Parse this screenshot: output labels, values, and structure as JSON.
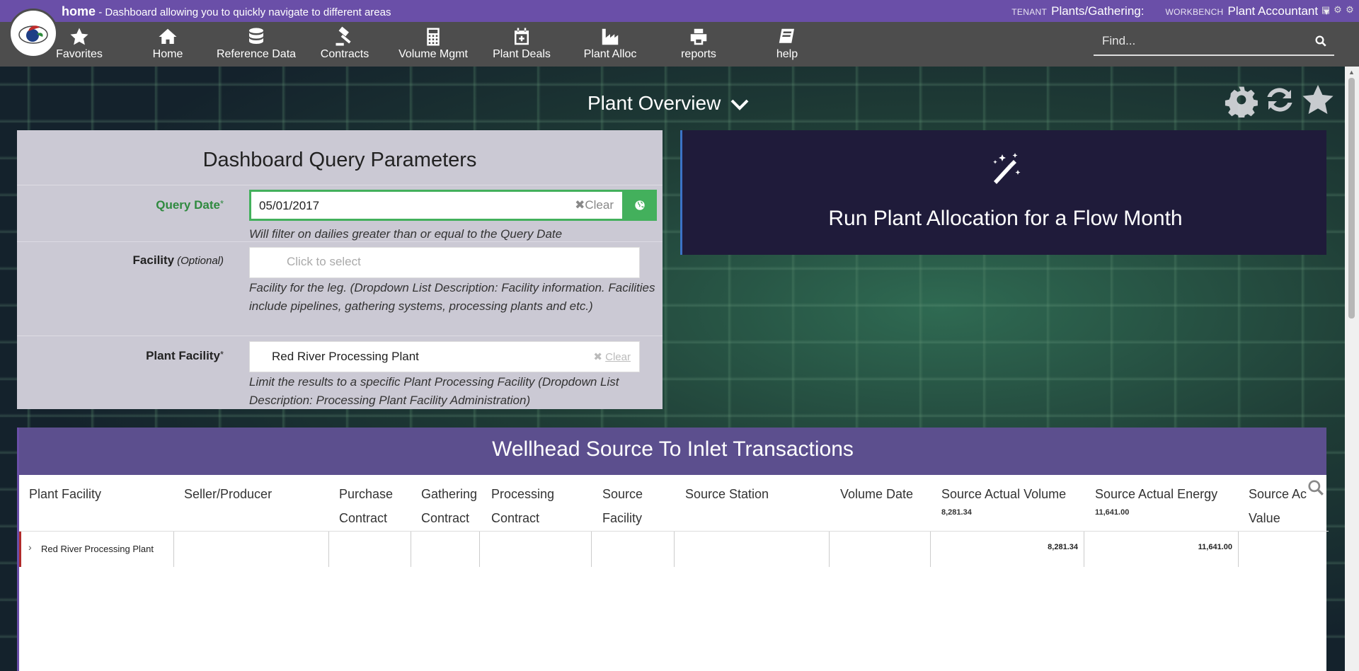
{
  "topbar": {
    "page": "home",
    "description": "- Dashboard allowing you to quickly navigate to different areas",
    "tenant_label": "TENANT",
    "tenant_value": "Plants/Gathering:",
    "workbench_label": "WORKBENCH",
    "workbench_value": "Plant Accountant"
  },
  "nav": {
    "items": [
      {
        "label": "Favorites",
        "icon": "star-icon"
      },
      {
        "label": "Home",
        "icon": "home-icon"
      },
      {
        "label": "Reference Data",
        "icon": "database-icon"
      },
      {
        "label": "Contracts",
        "icon": "gavel-icon"
      },
      {
        "label": "Volume Mgmt",
        "icon": "calculator-icon"
      },
      {
        "label": "Plant Deals",
        "icon": "calendar-plus-icon"
      },
      {
        "label": "Plant Alloc",
        "icon": "factory-icon"
      },
      {
        "label": "reports",
        "icon": "printer-icon"
      },
      {
        "label": "help",
        "icon": "book-icon"
      }
    ],
    "find_placeholder": "Find..."
  },
  "page_title": "Plant Overview",
  "params": {
    "title": "Dashboard Query Parameters",
    "query_date": {
      "label": "Query Date",
      "value": "05/01/2017",
      "clear": "Clear",
      "hint": "Will filter on dailies greater than or equal to the Query Date"
    },
    "facility": {
      "label": "Facility",
      "optional": "(Optional)",
      "placeholder": "Click to select",
      "hint": "Facility for the leg. (Dropdown List Description: Facility information. Facilities include pipelines, gathering systems, processing plants and etc.)"
    },
    "plant_facility": {
      "label": "Plant Facility",
      "value": "Red River Processing Plant",
      "clear": "Clear",
      "hint": "Limit the results to a specific Plant Processing Facility (Dropdown List Description: Processing Plant Facility Administration)"
    }
  },
  "run_panel": {
    "label": "Run Plant Allocation for a Flow Month"
  },
  "table": {
    "title": "Wellhead Source To Inlet Transactions",
    "columns": [
      {
        "line1": "Plant Facility",
        "line2": ""
      },
      {
        "line1": "Seller/Producer",
        "line2": ""
      },
      {
        "line1": "Purchase",
        "line2": "Contract"
      },
      {
        "line1": "Gathering",
        "line2": "Contract"
      },
      {
        "line1": "Processing",
        "line2": "Contract"
      },
      {
        "line1": "Source",
        "line2": "Facility"
      },
      {
        "line1": "Source Station",
        "line2": ""
      },
      {
        "line1": "Volume Date",
        "line2": ""
      },
      {
        "line1": "Source Actual Volume",
        "line2": "",
        "total": "8,281.34"
      },
      {
        "line1": "Source Actual Energy",
        "line2": "",
        "total": "11,641.00"
      },
      {
        "line1": "Source Ac",
        "line2": "Value"
      }
    ],
    "row": {
      "plant_facility": "Red River Processing Plant",
      "volume": "8,281.34",
      "energy": "11,641.00"
    }
  }
}
